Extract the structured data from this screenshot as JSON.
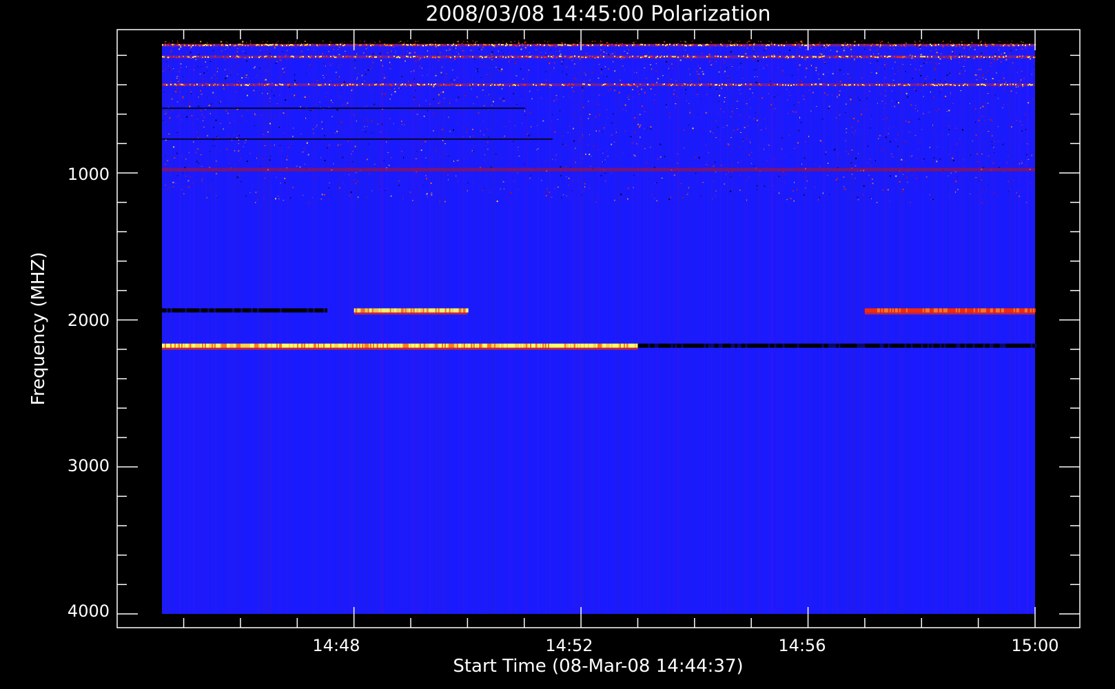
{
  "chart_data": {
    "type": "heatmap",
    "title": "2008/03/08 14:45:00 Polarization",
    "xlabel": "Start Time (08-Mar-08 14:44:37)",
    "ylabel": "Frequency (MHZ)",
    "x_tick_labels": [
      "14:48",
      "14:52",
      "14:56",
      "15:00"
    ],
    "y_tick_labels": [
      "1000",
      "2000",
      "3000",
      "4000"
    ],
    "x_range": [
      "14:44:37",
      "15:00:00"
    ],
    "y_range_mhz": [
      100,
      4000
    ],
    "y_axis_inverted": true,
    "background_color": "#1a1aff",
    "colormap": [
      "#000000",
      "#1a1aff",
      "#ff2a00",
      "#ffff66"
    ],
    "features": [
      {
        "name": "rfi-band",
        "freq_mhz": 130,
        "intensity": "speckled-bright"
      },
      {
        "name": "rfi-band",
        "freq_mhz": 210,
        "intensity": "speckled-bright"
      },
      {
        "name": "rfi-band",
        "freq_mhz": 400,
        "intensity": "speckled-bright"
      },
      {
        "name": "dark-line",
        "freq_mhz": 560,
        "time_range": [
          "14:44:37",
          "14:51:00"
        ]
      },
      {
        "name": "dark-line",
        "freq_mhz": 770,
        "time_range": [
          "14:44:37",
          "14:51:30"
        ]
      },
      {
        "name": "red-band",
        "freq_mhz": 975,
        "intensity": "moderate"
      },
      {
        "name": "dark-band",
        "freq_mhz": 1935,
        "time_range": [
          "14:44:37",
          "14:47:30"
        ]
      },
      {
        "name": "emission-band",
        "freq_mhz": 1935,
        "time_range": [
          "14:48:00",
          "14:50:00"
        ],
        "intensity": "strong"
      },
      {
        "name": "emission-band",
        "freq_mhz": 1935,
        "time_range": [
          "14:57:00",
          "15:00:00"
        ],
        "intensity": "moderate"
      },
      {
        "name": "emission-band",
        "freq_mhz": 2175,
        "time_range": [
          "14:44:37",
          "14:53:00"
        ],
        "intensity": "strong"
      },
      {
        "name": "dark-band",
        "freq_mhz": 2175,
        "time_range": [
          "14:53:00",
          "15:00:00"
        ]
      }
    ]
  }
}
